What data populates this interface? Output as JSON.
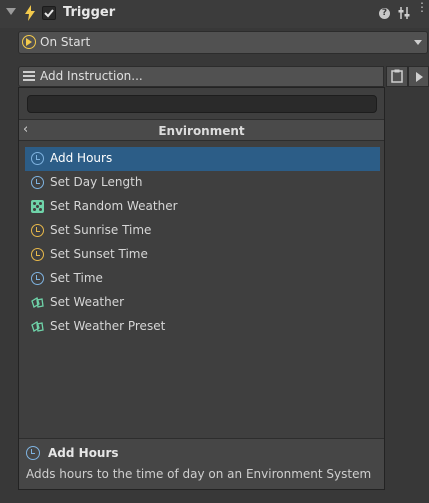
{
  "header": {
    "title": "Trigger",
    "help_icon_glyph": "?",
    "more_icon_glyph": "⋮"
  },
  "event": {
    "label": "On Start"
  },
  "instruction_bar": {
    "label": "Add Instruction..."
  },
  "picker": {
    "search_value": "",
    "category_title": "Environment",
    "back_glyph": "‹",
    "items": [
      {
        "label": "Add Hours",
        "icon": "clock-icon",
        "icon_color": "#7fb3e0",
        "selected": true
      },
      {
        "label": "Set Day Length",
        "icon": "clock-icon",
        "icon_color": "#7fb3e0",
        "selected": false
      },
      {
        "label": "Set Random Weather",
        "icon": "dice-icon",
        "icon_color": "#6fd3a9",
        "selected": false
      },
      {
        "label": "Set Sunrise Time",
        "icon": "clock-icon",
        "icon_color": "#e8b84a",
        "selected": false
      },
      {
        "label": "Set Sunset Time",
        "icon": "clock-icon",
        "icon_color": "#e8b84a",
        "selected": false
      },
      {
        "label": "Set Time",
        "icon": "clock-icon",
        "icon_color": "#7fb3e0",
        "selected": false
      },
      {
        "label": "Set Weather",
        "icon": "weather-icon",
        "icon_color": "#6fd3a9",
        "selected": false
      },
      {
        "label": "Set Weather Preset",
        "icon": "weather-icon",
        "icon_color": "#6fd3a9",
        "selected": false
      }
    ]
  },
  "description": {
    "title": "Add Hours",
    "text": "Adds hours to the time of day on an Environment System"
  },
  "colors": {
    "selection": "#2c5d87",
    "accent_yellow": "#f2c94c"
  }
}
